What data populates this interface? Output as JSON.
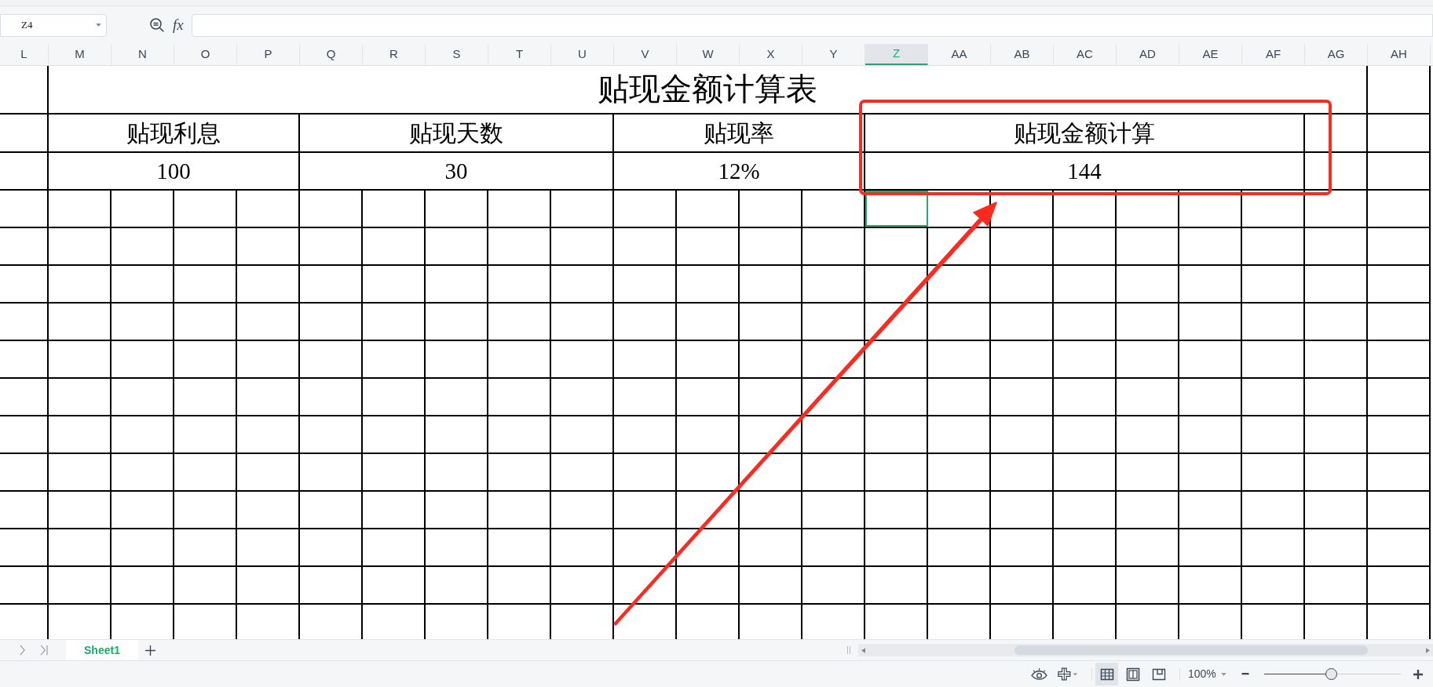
{
  "name_box": {
    "value": "Z4"
  },
  "formula_label": "fx",
  "columns": [
    {
      "label": "L",
      "selected": false
    },
    {
      "label": "M",
      "selected": false
    },
    {
      "label": "N",
      "selected": false
    },
    {
      "label": "O",
      "selected": false
    },
    {
      "label": "P",
      "selected": false
    },
    {
      "label": "Q",
      "selected": false
    },
    {
      "label": "R",
      "selected": false
    },
    {
      "label": "S",
      "selected": false
    },
    {
      "label": "T",
      "selected": false
    },
    {
      "label": "U",
      "selected": false
    },
    {
      "label": "V",
      "selected": false
    },
    {
      "label": "W",
      "selected": false
    },
    {
      "label": "X",
      "selected": false
    },
    {
      "label": "Y",
      "selected": false
    },
    {
      "label": "Z",
      "selected": true
    },
    {
      "label": "AA",
      "selected": false
    },
    {
      "label": "AB",
      "selected": false
    },
    {
      "label": "AC",
      "selected": false
    },
    {
      "label": "AD",
      "selected": false
    },
    {
      "label": "AE",
      "selected": false
    },
    {
      "label": "AF",
      "selected": false
    },
    {
      "label": "AG",
      "selected": false
    },
    {
      "label": "AH",
      "selected": false
    }
  ],
  "sheet": {
    "title": "贴现金额计算表",
    "headers": [
      "贴现利息",
      "贴现天数",
      "贴现率",
      "贴现金额计算"
    ],
    "values": [
      "100",
      "30",
      "12%",
      "144"
    ]
  },
  "sheet_tabs": [
    {
      "label": "Sheet1",
      "selected": true
    }
  ],
  "status_bar": {
    "view_modes": [
      {
        "kind": "normal",
        "selected": true
      },
      {
        "kind": "reading",
        "selected": false
      },
      {
        "kind": "page",
        "selected": false
      }
    ],
    "zoom": "100%",
    "zoom_slider": {
      "level": 0.49
    }
  }
}
